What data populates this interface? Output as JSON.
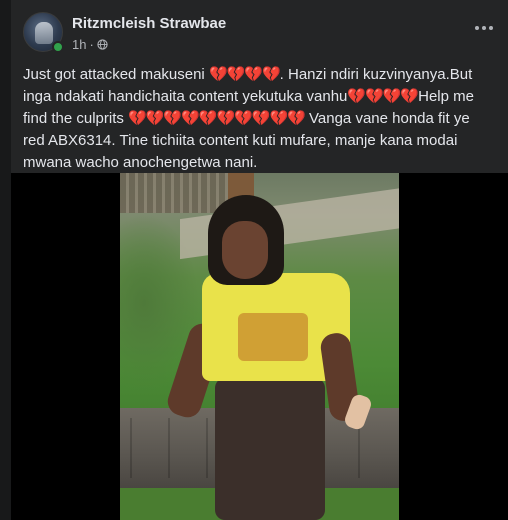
{
  "post": {
    "author": "Ritzmcleish Strawbae",
    "time": "1h",
    "separator": "·",
    "text_lines": [
      {
        "before": "Just got attacked makuseni ",
        "hearts": "💔💔💔💔",
        "after": ". Hanzi ndiri kuzvinyanya.But"
      },
      {
        "before": "inga ndakati handichaita content yekutuka vanhu",
        "hearts": "💔💔💔💔",
        "after": "Help me"
      },
      {
        "before": "find the culprits ",
        "hearts": "💔💔💔💔💔💔💔💔💔💔",
        "after": " Vanga vane honda fit ye"
      },
      {
        "before": "red ABX6314. Tine tichiita content kuti mufare, manje kana modai",
        "hearts": "",
        "after": ""
      },
      {
        "before": "mwana wacho anochengetwa nani.",
        "hearts": "",
        "after": ""
      }
    ]
  },
  "icons": {
    "globe": "globe-icon",
    "more": "more-options-icon",
    "online": "online-status-icon"
  },
  "colors": {
    "background": "#18191a",
    "card": "#242526",
    "text_primary": "#e4e6eb",
    "text_secondary": "#b0b3b8",
    "online": "#31a24c",
    "broken_heart": "#e0245e"
  }
}
